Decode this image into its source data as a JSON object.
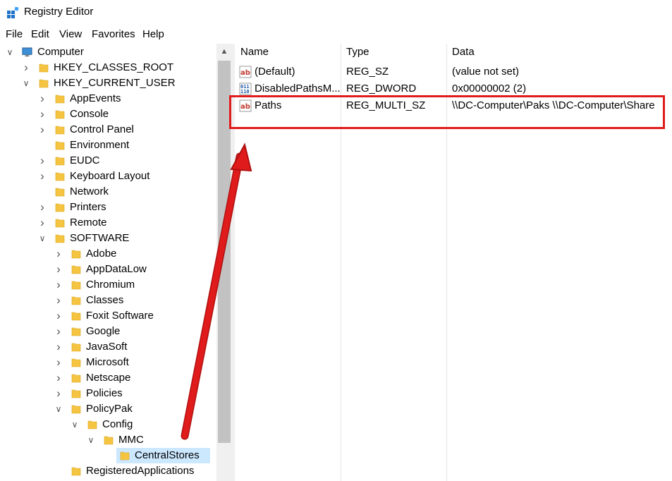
{
  "window": {
    "title": "Registry Editor"
  },
  "menu": [
    "File",
    "Edit",
    "View",
    "Favorites",
    "Help"
  ],
  "tree": [
    {
      "label": "Computer",
      "depth": 0,
      "expanded": true,
      "icon": "computer-icon"
    },
    {
      "label": "HKEY_CLASSES_ROOT",
      "depth": 1,
      "expanded": false
    },
    {
      "label": "HKEY_CURRENT_USER",
      "depth": 1,
      "expanded": true
    },
    {
      "label": "AppEvents",
      "depth": 2,
      "expanded": false
    },
    {
      "label": "Console",
      "depth": 2,
      "expanded": false
    },
    {
      "label": "Control Panel",
      "depth": 2,
      "expanded": false
    },
    {
      "label": "Environment",
      "depth": 2,
      "leaf": true
    },
    {
      "label": "EUDC",
      "depth": 2,
      "expanded": false
    },
    {
      "label": "Keyboard Layout",
      "depth": 2,
      "expanded": false
    },
    {
      "label": "Network",
      "depth": 2,
      "leaf": true
    },
    {
      "label": "Printers",
      "depth": 2,
      "expanded": false
    },
    {
      "label": "Remote",
      "depth": 2,
      "expanded": false
    },
    {
      "label": "SOFTWARE",
      "depth": 2,
      "expanded": true
    },
    {
      "label": "Adobe",
      "depth": 3,
      "expanded": false
    },
    {
      "label": "AppDataLow",
      "depth": 3,
      "expanded": false
    },
    {
      "label": "Chromium",
      "depth": 3,
      "expanded": false
    },
    {
      "label": "Classes",
      "depth": 3,
      "expanded": false
    },
    {
      "label": "Foxit Software",
      "depth": 3,
      "expanded": false
    },
    {
      "label": "Google",
      "depth": 3,
      "expanded": false
    },
    {
      "label": "JavaSoft",
      "depth": 3,
      "expanded": false
    },
    {
      "label": "Microsoft",
      "depth": 3,
      "expanded": false
    },
    {
      "label": "Netscape",
      "depth": 3,
      "expanded": false
    },
    {
      "label": "Policies",
      "depth": 3,
      "expanded": false
    },
    {
      "label": "PolicyPak",
      "depth": 3,
      "expanded": true
    },
    {
      "label": "Config",
      "depth": 4,
      "expanded": true
    },
    {
      "label": "MMC",
      "depth": 5,
      "expanded": true
    },
    {
      "label": "CentralStores",
      "depth": 6,
      "leaf": true,
      "selected": true
    },
    {
      "label": "RegisteredApplications",
      "depth": 3,
      "leaf": true
    }
  ],
  "columns": {
    "name": "Name",
    "type": "Type",
    "data": "Data"
  },
  "values": [
    {
      "name": "(Default)",
      "type": "REG_SZ",
      "data": "(value not set)",
      "icon": "string-value-icon"
    },
    {
      "name": "DisabledPathsM...",
      "type": "REG_DWORD",
      "data": "0x00000002 (2)",
      "icon": "binary-value-icon"
    },
    {
      "name": "Paths",
      "type": "REG_MULTI_SZ",
      "data": "\\\\DC-Computer\\Paks \\\\DC-Computer\\Share",
      "icon": "string-value-icon"
    }
  ],
  "colors": {
    "highlight": "#e01b1b",
    "selection": "#cce8ff",
    "folder": "#f5c542"
  }
}
